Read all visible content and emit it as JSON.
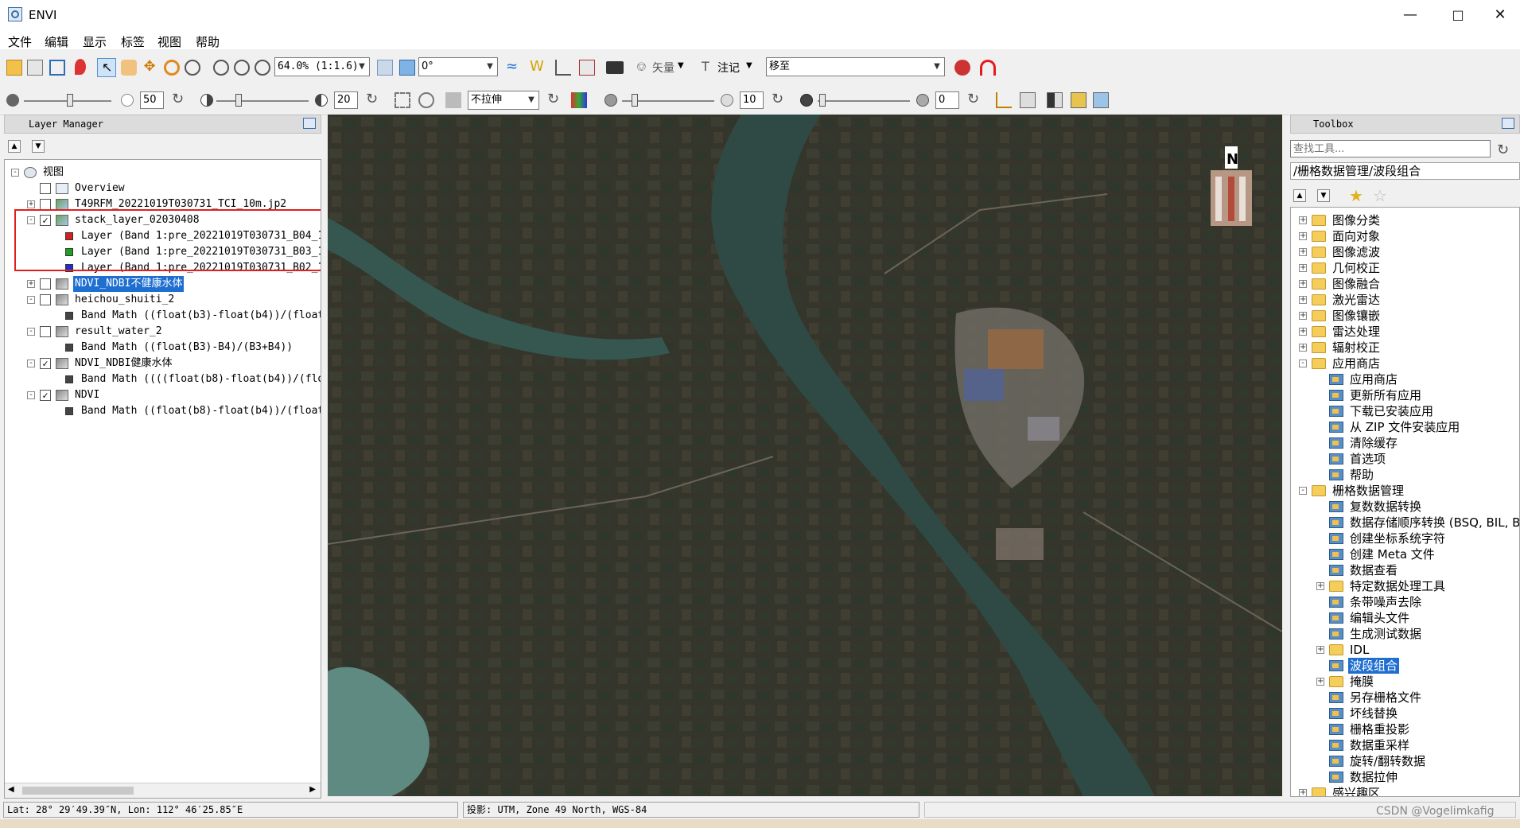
{
  "window": {
    "title": "ENVI"
  },
  "menu": [
    "文件",
    "编辑",
    "显示",
    "标签",
    "视图",
    "帮助"
  ],
  "toolbar1": {
    "zoom": "64.0% (1:1.6)",
    "rotation": "0°",
    "vector_label": "矢量",
    "annotation_label": "注记",
    "goto_value": "移至"
  },
  "toolbar2": {
    "brightness": "50",
    "contrast": "20",
    "stretch": "不拉伸",
    "sharpen": "10",
    "transparency": "0"
  },
  "layer_manager": {
    "title": "Layer Manager",
    "tree": [
      {
        "label": "视图",
        "level": 0,
        "expander": "-",
        "checkbox": null,
        "icon": "view"
      },
      {
        "label": "Overview",
        "level": 1,
        "expander": null,
        "checkbox": false,
        "icon": "overview"
      },
      {
        "label": "T49RFM_20221019T030731_TCI_10m.jp2",
        "level": 1,
        "expander": "+",
        "checkbox": false,
        "icon": "raster-rgb"
      },
      {
        "label": "stack_layer_02030408",
        "level": 1,
        "expander": "-",
        "checkbox": true,
        "icon": "raster-rgb"
      },
      {
        "label": "Layer (Band 1:pre_20221019T030731_B04_1",
        "level": 2,
        "expander": null,
        "checkbox": null,
        "icon": "band-red"
      },
      {
        "label": "Layer (Band 1:pre_20221019T030731_B03_1",
        "level": 2,
        "expander": null,
        "checkbox": null,
        "icon": "band-green"
      },
      {
        "label": "Layer (Band 1:pre_20221019T030731_B02_1",
        "level": 2,
        "expander": null,
        "checkbox": null,
        "icon": "band-blue"
      },
      {
        "label": "NDVI_NDBI不健康水体",
        "level": 1,
        "expander": "+",
        "checkbox": false,
        "icon": "raster-gray",
        "selected": true
      },
      {
        "label": "heichou_shuiti_2",
        "level": 1,
        "expander": "-",
        "checkbox": false,
        "icon": "raster-gray"
      },
      {
        "label": "Band Math ((float(b3)-float(b4))/(float",
        "level": 2,
        "expander": null,
        "checkbox": null,
        "icon": "band-gray"
      },
      {
        "label": "result_water_2",
        "level": 1,
        "expander": "-",
        "checkbox": false,
        "icon": "raster-gray"
      },
      {
        "label": "Band Math ((float(B3)-B4)/(B3+B4))",
        "level": 2,
        "expander": null,
        "checkbox": null,
        "icon": "band-gray"
      },
      {
        "label": "NDVI_NDBI健康水体",
        "level": 1,
        "expander": "-",
        "checkbox": true,
        "icon": "raster-gray"
      },
      {
        "label": "Band Math ((((float(b8)-float(b4))/(flo",
        "level": 2,
        "expander": null,
        "checkbox": null,
        "icon": "band-gray"
      },
      {
        "label": "NDVI",
        "level": 1,
        "expander": "-",
        "checkbox": true,
        "icon": "raster-gray"
      },
      {
        "label": "Band Math ((float(b8)-float(b4))/(float",
        "level": 2,
        "expander": null,
        "checkbox": null,
        "icon": "band-gray"
      }
    ]
  },
  "map": {
    "north_label": "N"
  },
  "toolbox": {
    "title": "Toolbox",
    "search_placeholder": "查找工具...",
    "path": "/栅格数据管理/波段组合",
    "tree": [
      {
        "label": "图像分类",
        "level": 0,
        "expander": "+",
        "icon": "folder"
      },
      {
        "label": "面向对象",
        "level": 0,
        "expander": "+",
        "icon": "folder"
      },
      {
        "label": "图像滤波",
        "level": 0,
        "expander": "+",
        "icon": "folder"
      },
      {
        "label": "几何校正",
        "level": 0,
        "expander": "+",
        "icon": "folder"
      },
      {
        "label": "图像融合",
        "level": 0,
        "expander": "+",
        "icon": "folder"
      },
      {
        "label": "激光雷达",
        "level": 0,
        "expander": "+",
        "icon": "folder"
      },
      {
        "label": "图像镶嵌",
        "level": 0,
        "expander": "+",
        "icon": "folder"
      },
      {
        "label": "雷达处理",
        "level": 0,
        "expander": "+",
        "icon": "folder"
      },
      {
        "label": "辐射校正",
        "level": 0,
        "expander": "+",
        "icon": "folder"
      },
      {
        "label": "应用商店",
        "level": 0,
        "expander": "-",
        "icon": "folder"
      },
      {
        "label": "应用商店",
        "level": 1,
        "expander": null,
        "icon": "tool"
      },
      {
        "label": "更新所有应用",
        "level": 1,
        "expander": null,
        "icon": "tool"
      },
      {
        "label": "下载已安装应用",
        "level": 1,
        "expander": null,
        "icon": "tool"
      },
      {
        "label": "从 ZIP 文件安装应用",
        "level": 1,
        "expander": null,
        "icon": "tool"
      },
      {
        "label": "清除缓存",
        "level": 1,
        "expander": null,
        "icon": "tool"
      },
      {
        "label": "首选项",
        "level": 1,
        "expander": null,
        "icon": "tool"
      },
      {
        "label": "帮助",
        "level": 1,
        "expander": null,
        "icon": "tool"
      },
      {
        "label": "栅格数据管理",
        "level": 0,
        "expander": "-",
        "icon": "folder"
      },
      {
        "label": "复数数据转换",
        "level": 1,
        "expander": null,
        "icon": "tool"
      },
      {
        "label": "数据存储顺序转换 (BSQ, BIL, B",
        "level": 1,
        "expander": null,
        "icon": "tool"
      },
      {
        "label": "创建坐标系统字符",
        "level": 1,
        "expander": null,
        "icon": "tool"
      },
      {
        "label": "创建 Meta 文件",
        "level": 1,
        "expander": null,
        "icon": "tool"
      },
      {
        "label": "数据查看",
        "level": 1,
        "expander": null,
        "icon": "tool"
      },
      {
        "label": "特定数据处理工具",
        "level": 1,
        "expander": "+",
        "icon": "folder"
      },
      {
        "label": "条带噪声去除",
        "level": 1,
        "expander": null,
        "icon": "tool"
      },
      {
        "label": "编辑头文件",
        "level": 1,
        "expander": null,
        "icon": "tool"
      },
      {
        "label": "生成测试数据",
        "level": 1,
        "expander": null,
        "icon": "tool"
      },
      {
        "label": "IDL",
        "level": 1,
        "expander": "+",
        "icon": "folder"
      },
      {
        "label": "波段组合",
        "level": 1,
        "expander": null,
        "icon": "tool",
        "selected": true
      },
      {
        "label": "掩膜",
        "level": 1,
        "expander": "+",
        "icon": "folder"
      },
      {
        "label": "另存栅格文件",
        "level": 1,
        "expander": null,
        "icon": "tool"
      },
      {
        "label": "坏线替换",
        "level": 1,
        "expander": null,
        "icon": "tool"
      },
      {
        "label": "栅格重投影",
        "level": 1,
        "expander": null,
        "icon": "tool"
      },
      {
        "label": "数据重采样",
        "level": 1,
        "expander": null,
        "icon": "tool"
      },
      {
        "label": "旋转/翻转数据",
        "level": 1,
        "expander": null,
        "icon": "tool"
      },
      {
        "label": "数据拉伸",
        "level": 1,
        "expander": null,
        "icon": "tool"
      },
      {
        "label": "感兴趣区",
        "level": 0,
        "expander": "+",
        "icon": "folder"
      }
    ]
  },
  "status": {
    "latlon": "Lat: 28° 29′49.39″N, Lon: 112° 46′25.85″E",
    "projection": "投影: UTM, Zone 49 North, WGS-84",
    "watermark": "CSDN @Vogelimkafig"
  }
}
